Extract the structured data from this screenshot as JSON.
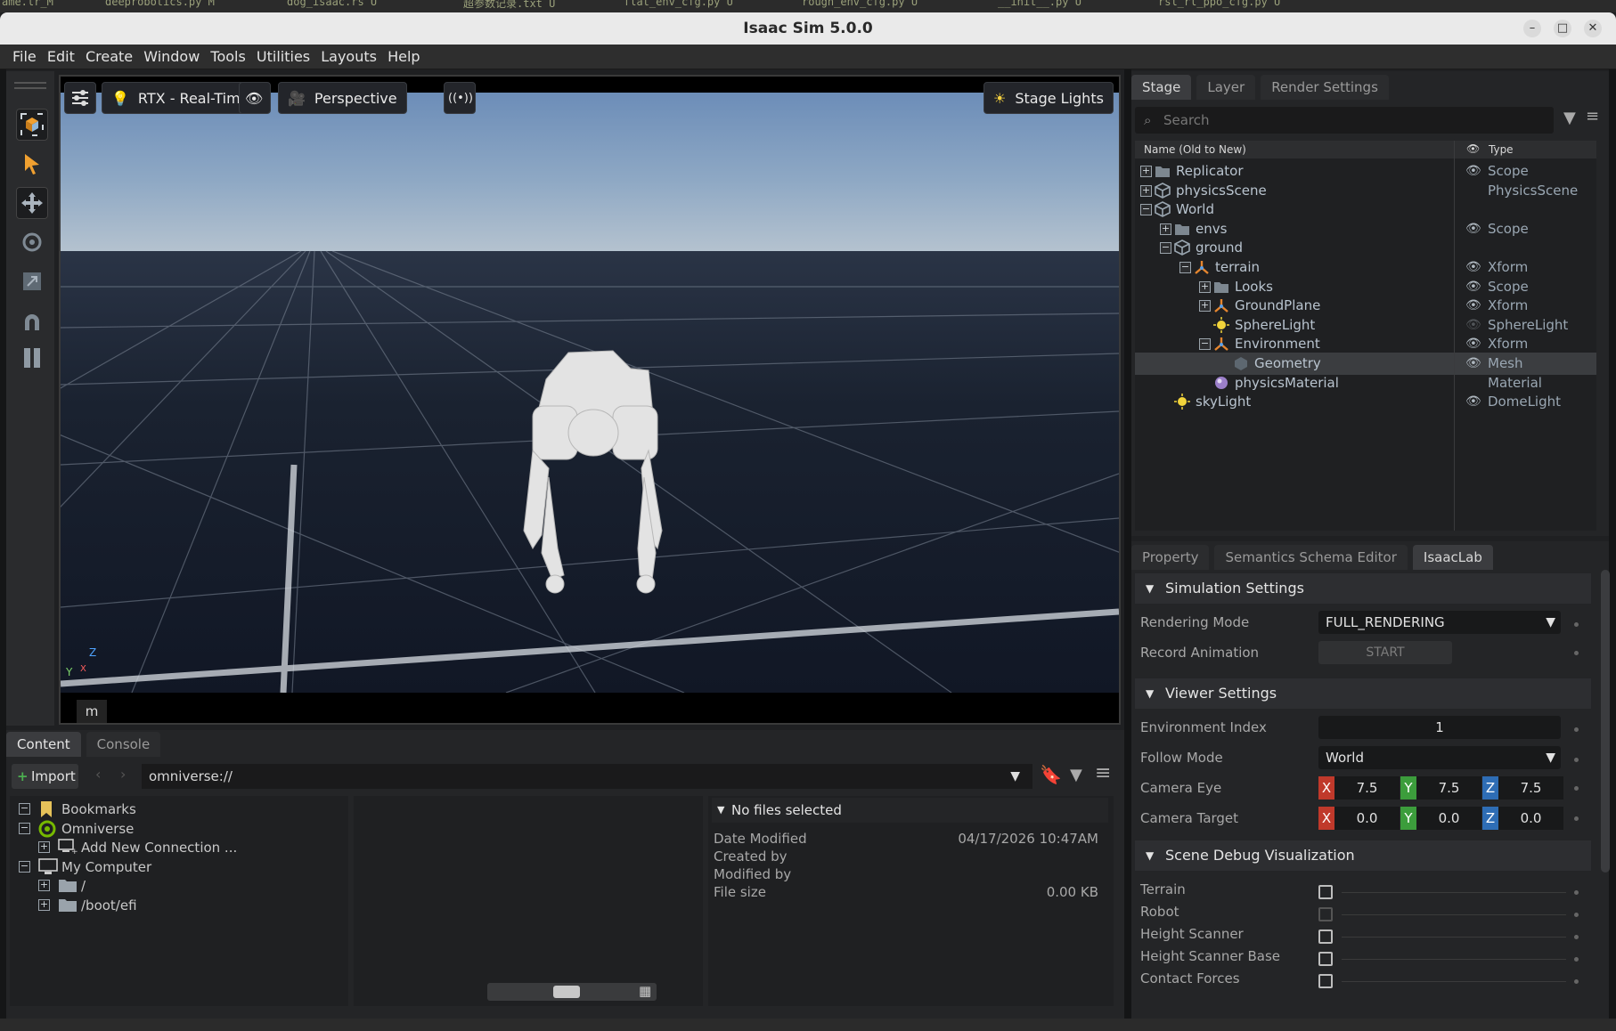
{
  "top_tabs": [
    "ame.lr_M",
    "deeprobotics.py M",
    "dog_isaac.rs U",
    "超参数记录.txt U",
    "flat_env_cfg.py U",
    "rough_env_cfg.py U",
    "__init__.py U",
    "rsl_rl_ppo_cfg.py U"
  ],
  "window": {
    "title": "Isaac Sim 5.0.0",
    "minimize": "–",
    "maximize": "□",
    "close": "✕"
  },
  "menu": [
    "File",
    "Edit",
    "Create",
    "Window",
    "Tools",
    "Utilities",
    "Layouts",
    "Help"
  ],
  "viewport": {
    "renderer_label": "RTX - Real-Time",
    "camera_label": "Perspective",
    "lights_label": "Stage Lights",
    "units_badge": "m",
    "axis_z": "Z",
    "axis_y": "Y",
    "axis_x": "X"
  },
  "stage": {
    "tabs": [
      "Stage",
      "Layer",
      "Render Settings"
    ],
    "search_placeholder": "Search",
    "col_name": "Name (Old to New)",
    "col_type": "Type",
    "rows": [
      {
        "name": "Replicator",
        "type": "Scope",
        "depth": 0,
        "expander": "+",
        "icon": "folder",
        "eye": true
      },
      {
        "name": "physicsScene",
        "type": "PhysicsScene",
        "depth": 0,
        "expander": "+",
        "icon": "cube",
        "eye": false
      },
      {
        "name": "World",
        "type": "",
        "depth": 0,
        "expander": "−",
        "icon": "cube",
        "eye": false
      },
      {
        "name": "envs",
        "type": "Scope",
        "depth": 1,
        "expander": "+",
        "icon": "folder",
        "eye": true
      },
      {
        "name": "ground",
        "type": "",
        "depth": 1,
        "expander": "−",
        "icon": "cube",
        "eye": false
      },
      {
        "name": "terrain",
        "type": "Xform",
        "depth": 2,
        "expander": "−",
        "icon": "xform",
        "eye": true
      },
      {
        "name": "Looks",
        "type": "Scope",
        "depth": 3,
        "expander": "+",
        "icon": "folder",
        "eye": true
      },
      {
        "name": "GroundPlane",
        "type": "Xform",
        "depth": 3,
        "expander": "+",
        "icon": "xform",
        "eye": true
      },
      {
        "name": "SphereLight",
        "type": "SphereLight",
        "depth": 3,
        "expander": "",
        "icon": "light",
        "eye": "dim"
      },
      {
        "name": "Environment",
        "type": "Xform",
        "depth": 3,
        "expander": "−",
        "icon": "xform",
        "eye": true
      },
      {
        "name": "Geometry",
        "type": "Mesh",
        "depth": 4,
        "expander": "",
        "icon": "mesh",
        "eye": true,
        "selected": true
      },
      {
        "name": "physicsMaterial",
        "type": "Material",
        "depth": 3,
        "expander": "",
        "icon": "material",
        "eye": false
      },
      {
        "name": "skyLight",
        "type": "DomeLight",
        "depth": 1,
        "expander": "",
        "icon": "light",
        "eye": true
      }
    ]
  },
  "props": {
    "tabs": [
      "Property",
      "Semantics Schema Editor",
      "IsaacLab"
    ],
    "sim_title": "Simulation Settings",
    "rendering_mode_label": "Rendering Mode",
    "rendering_mode_value": "FULL_RENDERING",
    "record_label": "Record Animation",
    "record_button": "START",
    "viewer_title": "Viewer Settings",
    "env_index_label": "Environment Index",
    "env_index_value": "1",
    "follow_label": "Follow Mode",
    "follow_value": "World",
    "eye_label": "Camera Eye",
    "target_label": "Camera Target",
    "eye": [
      "7.5",
      "7.5",
      "7.5"
    ],
    "target": [
      "0.0",
      "0.0",
      "0.0"
    ],
    "vec_labels": [
      "X",
      "Y",
      "Z"
    ],
    "debug_title": "Scene Debug Visualization",
    "debug_items": [
      "Terrain",
      "Robot",
      "Height Scanner",
      "Height Scanner Base",
      "Contact Forces"
    ]
  },
  "content": {
    "tabs": [
      "Content",
      "Console"
    ],
    "import_label": "Import",
    "path": "omniverse://",
    "tree": [
      {
        "label": "Bookmarks",
        "depth": 0,
        "exp": "−",
        "icon": "bookmark"
      },
      {
        "label": "Omniverse",
        "depth": 0,
        "exp": "−",
        "icon": "omniverse"
      },
      {
        "label": "Add New Connection ...",
        "depth": 1,
        "exp": "+",
        "icon": "connection"
      },
      {
        "label": "My Computer",
        "depth": 0,
        "exp": "−",
        "icon": "computer"
      },
      {
        "label": "/",
        "depth": 1,
        "exp": "+",
        "icon": "folder"
      },
      {
        "label": "/boot/efi",
        "depth": 1,
        "exp": "+",
        "icon": "folder"
      }
    ],
    "no_files": "No files selected",
    "date_modified_label": "Date Modified",
    "date_modified_value": "04/17/2026 10:47AM",
    "created_by_label": "Created by",
    "modified_by_label": "Modified by",
    "file_size_label": "File size",
    "file_size_value": "0.00 KB"
  }
}
